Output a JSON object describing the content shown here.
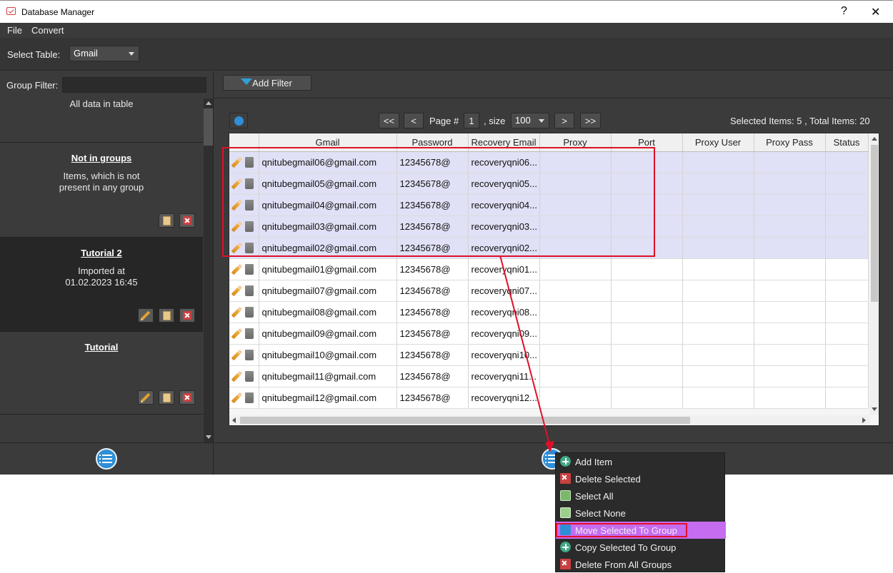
{
  "window": {
    "title": "Database Manager",
    "help_glyph": "?",
    "close_glyph": "✕"
  },
  "menu": {
    "file": "File",
    "convert": "Convert"
  },
  "toolbar": {
    "select_table_label": "Select Table:",
    "table_value": "Gmail"
  },
  "left": {
    "group_filter_label": "Group Filter:",
    "group_filter_value": "",
    "groups": [
      {
        "name": "",
        "desc": "All data in table"
      },
      {
        "name": "Not in groups",
        "desc": "Items, which is not\npresent in any group"
      },
      {
        "name": "Tutorial 2",
        "desc": "Imported at\n01.02.2023 16:45"
      },
      {
        "name": "Tutorial",
        "desc": ""
      }
    ]
  },
  "right": {
    "add_filter_label": "Add Filter",
    "pager": {
      "first": "<<",
      "prev": "<",
      "page_label": "Page #",
      "page": "1",
      "size_label": ", size",
      "size": "100",
      "next": ">",
      "last": ">>"
    },
    "selected_label": "Selected Items:",
    "selected_count": "5",
    "total_label": ", Total Items:",
    "total_count": "20"
  },
  "grid": {
    "columns": [
      "Gmail",
      "Password",
      "Recovery Email",
      "Proxy",
      "Port",
      "Proxy User",
      "Proxy Pass",
      "Status"
    ],
    "rows": [
      {
        "gmail": "qnitubegmail06@gmail.com",
        "password": "12345678@",
        "recovery": "recoveryqni06...",
        "selected": true
      },
      {
        "gmail": "qnitubegmail05@gmail.com",
        "password": "12345678@",
        "recovery": "recoveryqni05...",
        "selected": true
      },
      {
        "gmail": "qnitubegmail04@gmail.com",
        "password": "12345678@",
        "recovery": "recoveryqni04...",
        "selected": true
      },
      {
        "gmail": "qnitubegmail03@gmail.com",
        "password": "12345678@",
        "recovery": "recoveryqni03...",
        "selected": true
      },
      {
        "gmail": "qnitubegmail02@gmail.com",
        "password": "12345678@",
        "recovery": "recoveryqni02...",
        "selected": true
      },
      {
        "gmail": "qnitubegmail01@gmail.com",
        "password": "12345678@",
        "recovery": "recoveryqni01...",
        "selected": false
      },
      {
        "gmail": "qnitubegmail07@gmail.com",
        "password": "12345678@",
        "recovery": "recoveryqni07...",
        "selected": false
      },
      {
        "gmail": "qnitubegmail08@gmail.com",
        "password": "12345678@",
        "recovery": "recoveryqni08...",
        "selected": false
      },
      {
        "gmail": "qnitubegmail09@gmail.com",
        "password": "12345678@",
        "recovery": "recoveryqni09...",
        "selected": false
      },
      {
        "gmail": "qnitubegmail10@gmail.com",
        "password": "12345678@",
        "recovery": "recoveryqni10...",
        "selected": false
      },
      {
        "gmail": "qnitubegmail11@gmail.com",
        "password": "12345678@",
        "recovery": "recoveryqni11...",
        "selected": false
      },
      {
        "gmail": "qnitubegmail12@gmail.com",
        "password": "12345678@",
        "recovery": "recoveryqni12...",
        "selected": false
      }
    ]
  },
  "context_menu": {
    "items": [
      {
        "label": "Add Item",
        "icon": "plus-circle-icon"
      },
      {
        "label": "Delete Selected",
        "icon": "red-x-icon"
      },
      {
        "label": "Select All",
        "icon": "checkbox-checked-icon"
      },
      {
        "label": "Select None",
        "icon": "checkbox-empty-icon"
      },
      {
        "label": "Move Selected To Group",
        "icon": "move-icon",
        "active": true
      },
      {
        "label": "Copy Selected To Group",
        "icon": "plus-circle-icon"
      },
      {
        "label": "Delete From All Groups",
        "icon": "red-x-icon"
      }
    ]
  },
  "colors": {
    "accent_blue": "#2f8ed6",
    "highlight_red": "#e0102a",
    "menu_active": "#c66cf0",
    "selected_row": "#e0e0f6"
  }
}
